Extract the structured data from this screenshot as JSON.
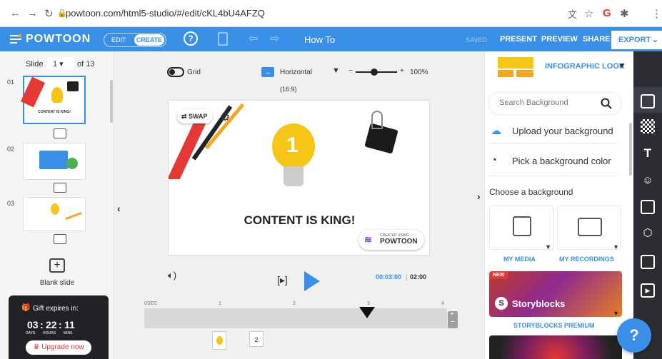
{
  "browser": {
    "url": "powtoon.com/html5-studio/#/edit/cKL4bU4AFZQ"
  },
  "topbar": {
    "logo": "POWTOON",
    "edit": "EDIT",
    "create": "CREATE",
    "title": "How To",
    "saved": "SAVED",
    "present": "PRESENT",
    "preview": "PREVIEW",
    "share": "SHARE",
    "export": "EXPORT"
  },
  "left": {
    "slide_label": "Slide",
    "slide_current": "1",
    "slide_total": "of 13",
    "slides": [
      "01",
      "02",
      "03"
    ],
    "thumb1_caption": "CONTENT IS KING!",
    "blank_slide": "Blank slide",
    "gift_title": "Gift expires in:",
    "countdown": {
      "days": "03",
      "hours": "22",
      "mins": "11",
      "days_label": "DAYS",
      "hours_label": "HOURS",
      "mins_label": "MINS"
    },
    "upgrade": "Upgrade now"
  },
  "center": {
    "grid": "Grid",
    "orientation": "Horizontal",
    "ratio": "(16:9)",
    "zoom": "100%",
    "zoom_fraction": 0.45,
    "swap": "SWAP",
    "headline": "CONTENT IS KING!",
    "badge_small": "CREATED USING",
    "badge_big": "POWTOON",
    "time_current": "00:03:00",
    "time_total": "02:00",
    "timeline_ticks": [
      "0SEC",
      "1",
      "2",
      "3",
      "4"
    ],
    "playhead_seconds": 3,
    "layer_number": "2"
  },
  "right": {
    "look": "INFOGRAPHIC LOOK",
    "search_placeholder": "Search Background",
    "upload": "Upload your background",
    "pick_color": "Pick a background color",
    "choose": "Choose a background",
    "my_media": "MY MEDIA",
    "my_recordings": "MY RECORDINGS",
    "new_badge": "NEW",
    "storyblocks": "Storyblocks",
    "storyblocks_premium": "STORYBLOCKS PREMIUM"
  },
  "colors": {
    "accent": "#3a8fe6",
    "dark": "#202225",
    "red": "#e53935",
    "orange": "#f5a623"
  }
}
